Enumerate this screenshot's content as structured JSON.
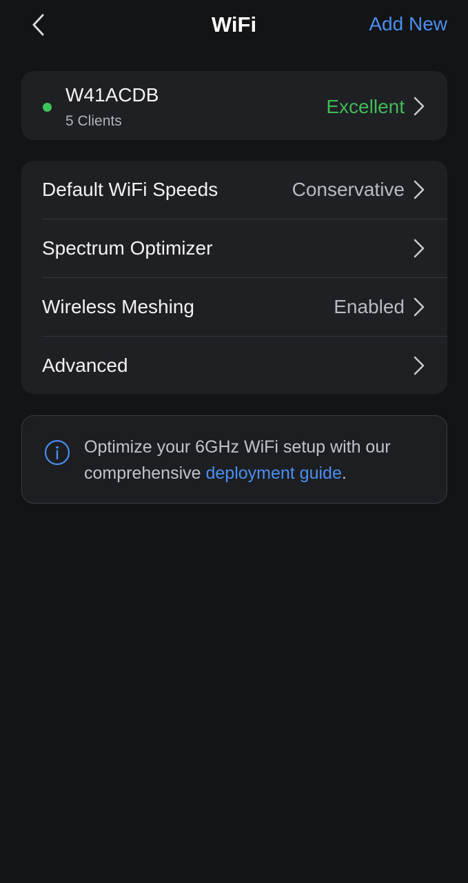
{
  "header": {
    "title": "WiFi",
    "add_new_label": "Add New"
  },
  "network": {
    "ssid": "W41ACDB",
    "clients": "5 Clients",
    "quality": "Excellent",
    "status_color": "#3ec45a",
    "quality_color": "#41bb57"
  },
  "settings": {
    "items": [
      {
        "label": "Default WiFi Speeds",
        "value": "Conservative"
      },
      {
        "label": "Spectrum Optimizer",
        "value": ""
      },
      {
        "label": "Wireless Meshing",
        "value": "Enabled"
      },
      {
        "label": "Advanced",
        "value": ""
      }
    ]
  },
  "info": {
    "text_before": "Optimize your 6GHz WiFi setup with our comprehensive ",
    "link_text": "deployment guide",
    "text_after": "."
  },
  "colors": {
    "background": "#131416",
    "card": "#1f2024",
    "accent": "#4a8ff0"
  },
  "icons": {
    "back": "chevron-left-icon",
    "row_arrow": "chevron-right-icon",
    "info": "info-circle-icon"
  }
}
